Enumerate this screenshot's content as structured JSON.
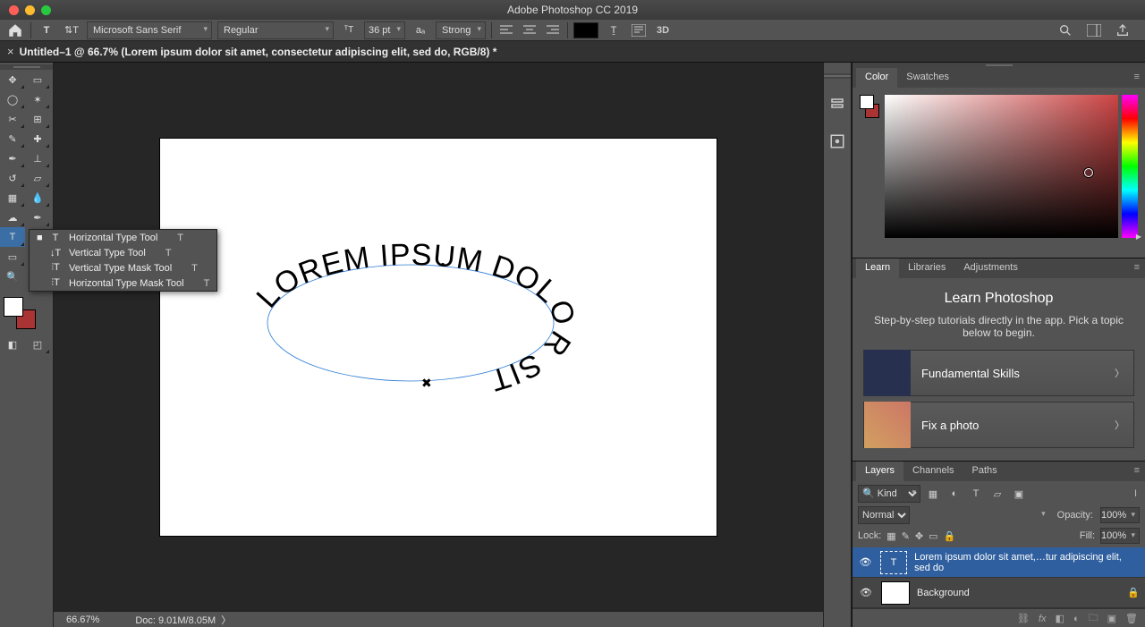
{
  "title": "Adobe Photoshop CC 2019",
  "document": {
    "tab_title": "Untitled–1 @ 66.7% (Lorem ipsum dolor sit amet, consectetur adipiscing elit, sed do, RGB/8) *"
  },
  "options": {
    "font_family": "Microsoft Sans Serif",
    "font_style": "Regular",
    "font_size": "36 pt",
    "aa": "Strong",
    "text_color": "#000000"
  },
  "type_flyout": {
    "items": [
      {
        "label": "Horizontal Type Tool",
        "shortcut": "T",
        "selected": true
      },
      {
        "label": "Vertical Type Tool",
        "shortcut": "T",
        "selected": false
      },
      {
        "label": "Vertical Type Mask Tool",
        "shortcut": "T",
        "selected": false
      },
      {
        "label": "Horizontal Type Mask Tool",
        "shortcut": "T",
        "selected": false
      }
    ]
  },
  "canvas": {
    "path_text": "LOREM IPSUM DOLOR SIT"
  },
  "status": {
    "zoom": "66.67%",
    "doc": "Doc: 9.01M/8.05M"
  },
  "panels": {
    "color": {
      "tabs": [
        "Color",
        "Swatches"
      ],
      "active": "Color",
      "picker_base": "#c44"
    },
    "learn": {
      "tabs": [
        "Learn",
        "Libraries",
        "Adjustments"
      ],
      "active": "Learn",
      "heading": "Learn Photoshop",
      "desc": "Step-by-step tutorials directly in the app. Pick a topic below to begin.",
      "cards": [
        {
          "title": "Fundamental Skills"
        },
        {
          "title": "Fix a photo"
        }
      ]
    },
    "layers": {
      "tabs": [
        "Layers",
        "Channels",
        "Paths"
      ],
      "active": "Layers",
      "filter_kind_label": "Kind",
      "blend_mode": "Normal",
      "opacity_label": "Opacity:",
      "opacity_value": "100%",
      "lock_label": "Lock:",
      "fill_label": "Fill:",
      "fill_value": "100%",
      "layers": [
        {
          "name": "Lorem ipsum dolor sit amet,…tur adipiscing elit, sed do",
          "type": "text",
          "active": true
        },
        {
          "name": "Background",
          "type": "pixel",
          "locked": true
        }
      ]
    }
  }
}
